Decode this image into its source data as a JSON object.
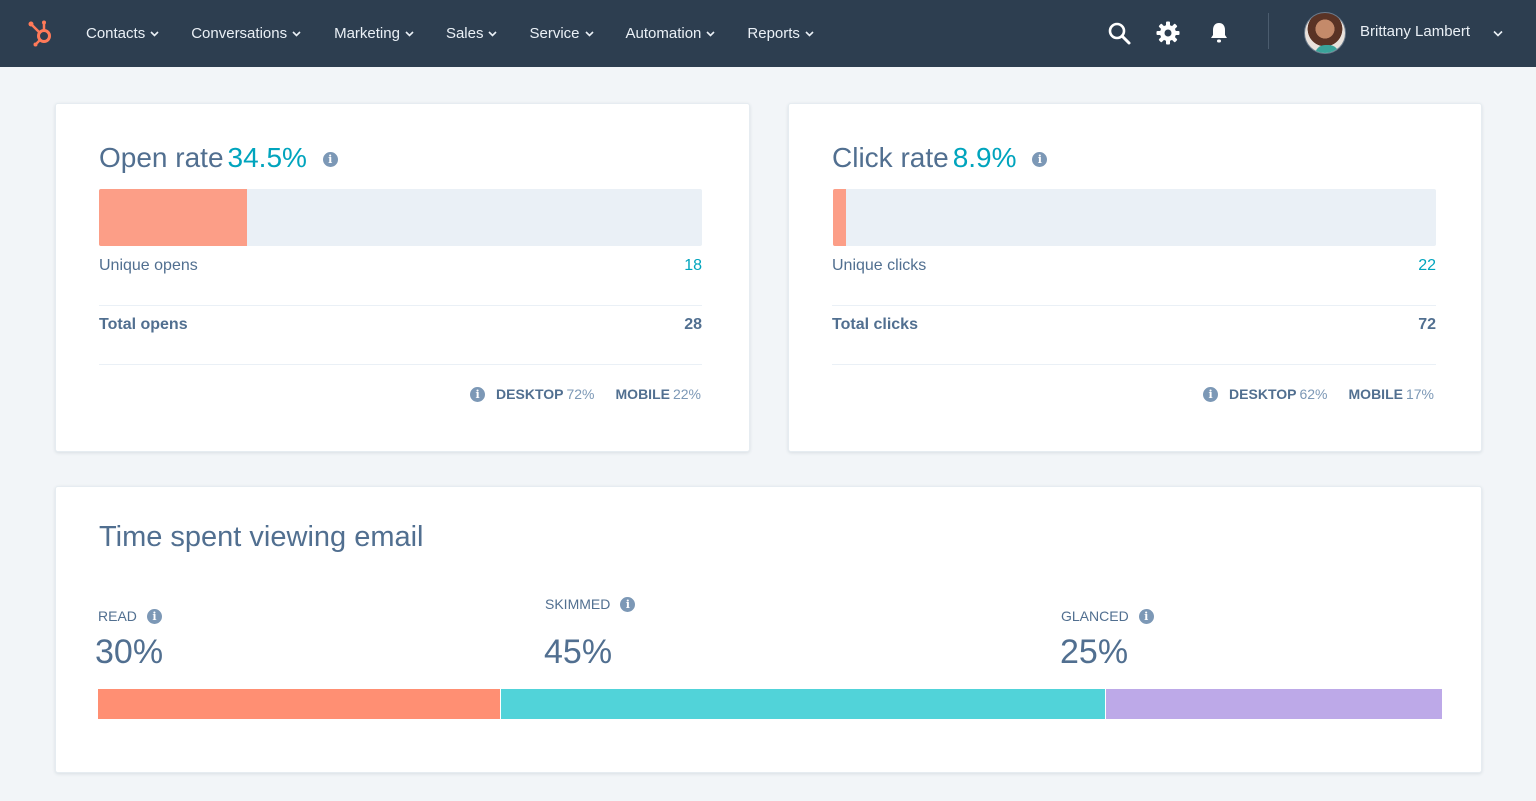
{
  "nav": {
    "logo_icon": "hubspot-sprocket-icon",
    "menu": [
      {
        "label": "Contacts"
      },
      {
        "label": "Conversations"
      },
      {
        "label": "Marketing"
      },
      {
        "label": "Sales"
      },
      {
        "label": "Service"
      },
      {
        "label": "Automation"
      },
      {
        "label": "Reports"
      }
    ],
    "icons": [
      "search-icon",
      "gear-icon",
      "bell-icon"
    ],
    "user": {
      "name": "Brittany Lambert"
    }
  },
  "open_card": {
    "title": "Open rate",
    "rate": "34.5%",
    "rate_fraction": 0.245,
    "rows": [
      {
        "label": "Unique opens",
        "value": "18"
      },
      {
        "label": "Total opens",
        "value": "28"
      }
    ],
    "devices": [
      {
        "label": "DESKTOP",
        "value": "72%"
      },
      {
        "label": "MOBILE",
        "value": "22%"
      }
    ]
  },
  "click_card": {
    "title": "Click rate",
    "rate": "8.9%",
    "rate_fraction": 0.022,
    "rows": [
      {
        "label": "Unique clicks",
        "value": "22"
      },
      {
        "label": "Total clicks",
        "value": "72"
      }
    ],
    "devices": [
      {
        "label": "DESKTOP",
        "value": "62%"
      },
      {
        "label": "MOBILE",
        "value": "17%"
      }
    ]
  },
  "time_card": {
    "title": "Time spent viewing email",
    "segments": [
      {
        "label": "READ",
        "value": "30%",
        "percent": 30,
        "color": "#ff8f73"
      },
      {
        "label": "SKIMMED",
        "value": "45%",
        "percent": 45,
        "color": "#51d3d9"
      },
      {
        "label": "GLANCED",
        "value": "25%",
        "percent": 25,
        "color": "#bda9e8"
      }
    ]
  },
  "colors": {
    "nav_bg": "#2d3e50",
    "accent_teal": "#00a4bd",
    "accent_orange": "#ff7a59"
  }
}
